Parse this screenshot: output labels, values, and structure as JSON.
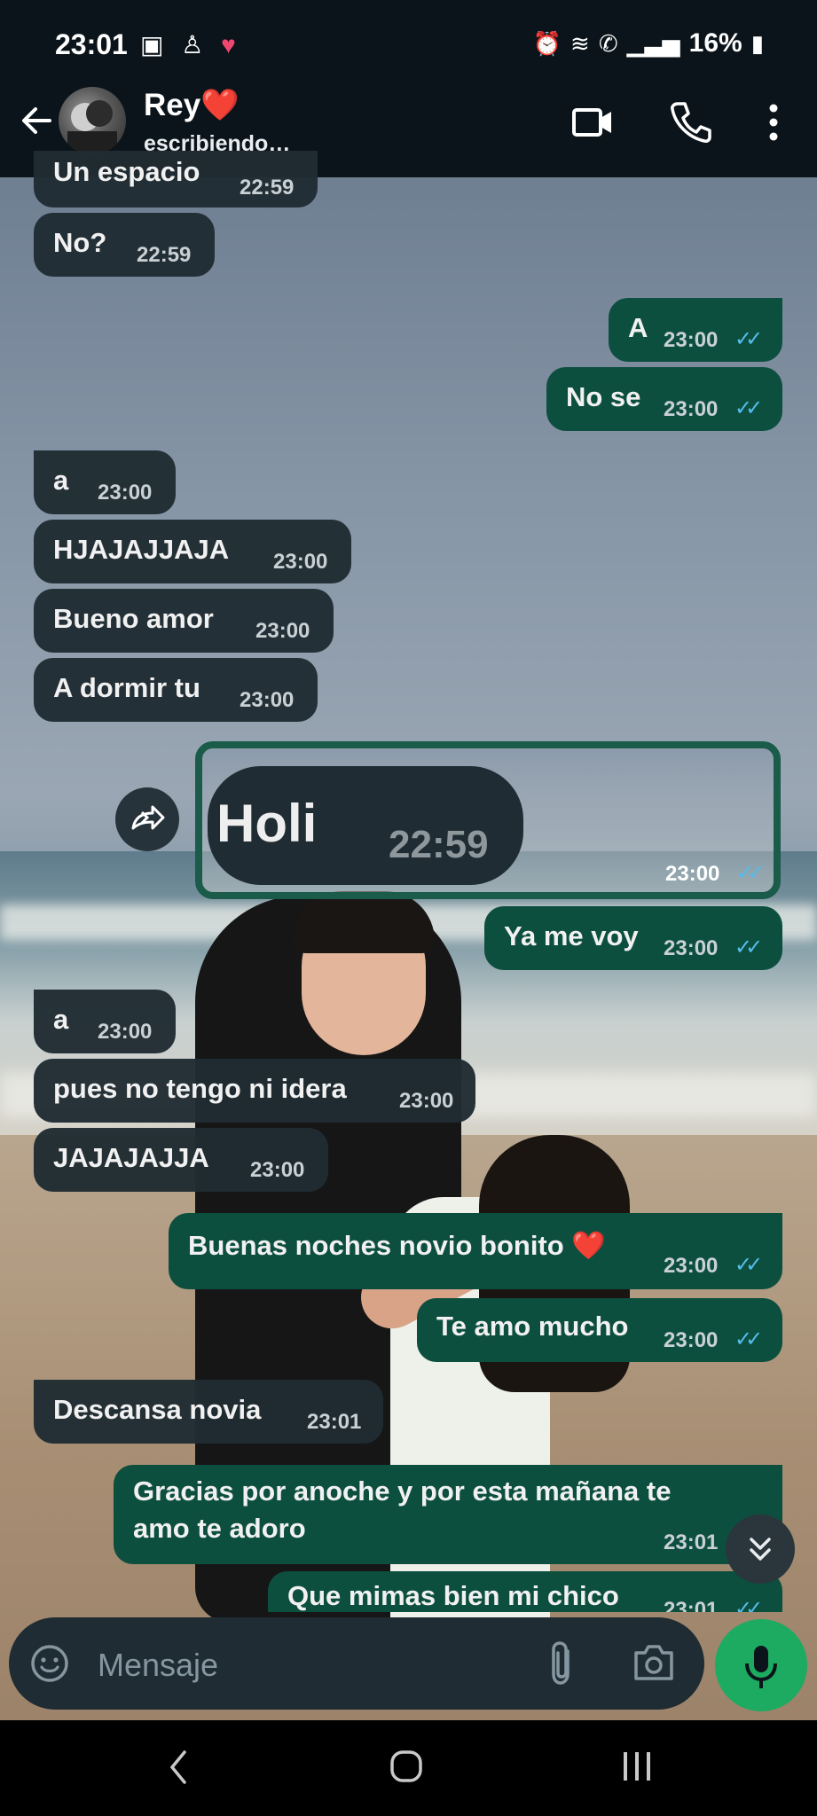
{
  "status_bar": {
    "time": "23:01",
    "left_icons": [
      "gallery-icon",
      "app-icon",
      "heart-icon"
    ],
    "right_icons": [
      "alarm-icon",
      "wifi-icon",
      "wifi-call-icon",
      "signal-icon"
    ],
    "battery": "16%"
  },
  "header": {
    "contact_name": "Rey❤️",
    "contact_status": "escribiendo…",
    "icons": [
      "back-arrow-icon",
      "video-call-icon",
      "phone-icon",
      "more-vert-icon"
    ]
  },
  "messages": [
    {
      "dir": "in",
      "text": "Un espacio",
      "time": "22:59"
    },
    {
      "dir": "in",
      "text": "No?",
      "time": "22:59"
    },
    {
      "dir": "out",
      "text": "A",
      "time": "23:00",
      "read": true
    },
    {
      "dir": "out",
      "text": "No se",
      "time": "23:00",
      "read": true
    },
    {
      "dir": "in",
      "text": "a",
      "time": "23:00"
    },
    {
      "dir": "in",
      "text": "HJAJAJJAJA",
      "time": "23:00"
    },
    {
      "dir": "in",
      "text": "Bueno amor",
      "time": "23:00"
    },
    {
      "dir": "in",
      "text": "A dormir tu",
      "time": "23:00"
    },
    {
      "dir": "out",
      "type": "image",
      "image_text": "Holi",
      "image_time": "22:59",
      "time": "23:00",
      "read": true
    },
    {
      "dir": "out",
      "text": "Ya me voy",
      "time": "23:00",
      "read": true
    },
    {
      "dir": "in",
      "text": "a",
      "time": "23:00"
    },
    {
      "dir": "in",
      "text": "pues no tengo ni idera",
      "time": "23:00"
    },
    {
      "dir": "in",
      "text": "JAJAJAJJA",
      "time": "23:00"
    },
    {
      "dir": "out",
      "text": "Buenas noches novio bonito ❤️",
      "time": "23:00",
      "read": true
    },
    {
      "dir": "out",
      "text": "Te amo mucho",
      "time": "23:00",
      "read": true
    },
    {
      "dir": "in",
      "text": "Descansa novia",
      "time": "23:01"
    },
    {
      "dir": "out",
      "text_line1": "Gracias por anoche y por esta mañana te",
      "text_line2": "amo te adoro",
      "time": "23:01"
    },
    {
      "dir": "out",
      "text": "Que mimas bien mi chico",
      "time": "23:01",
      "read": true
    }
  ],
  "input": {
    "placeholder": "Mensaje"
  },
  "colors": {
    "incoming_bubble": "#202c33",
    "outgoing_bubble": "#0d4f3f",
    "read_ticks": "#53bdeb",
    "mic_button": "#1daa61"
  }
}
